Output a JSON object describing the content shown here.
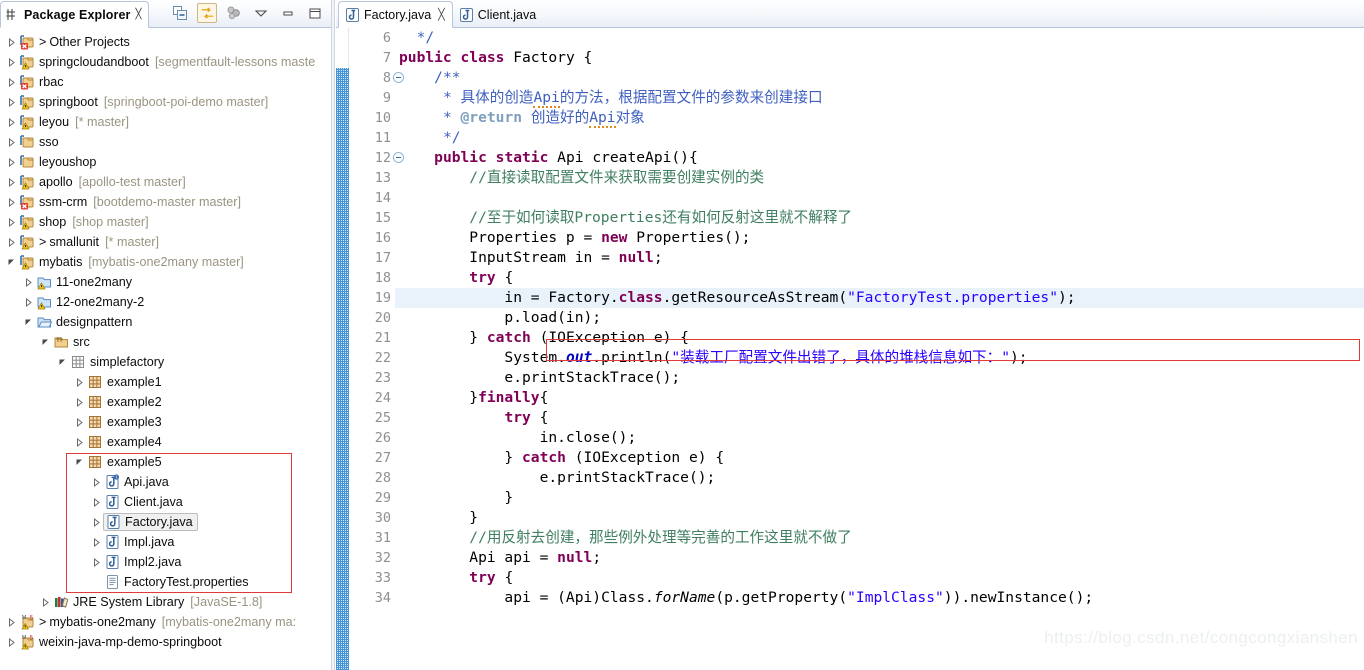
{
  "explorer": {
    "tab_title": "Package Explorer",
    "tab_close": "╳",
    "toolbar": [
      {
        "name": "collapse-all-icon",
        "title": "Collapse All"
      },
      {
        "name": "link-with-editor-icon",
        "title": "Link with Editor"
      },
      {
        "name": "focus-on-active-task-icon",
        "title": "Focus on Active Task"
      },
      {
        "name": "view-menu-icon",
        "title": "View Menu"
      },
      {
        "name": "minimize-icon",
        "title": "Minimize"
      },
      {
        "name": "maximize-icon",
        "title": "Maximize"
      }
    ],
    "tree": [
      {
        "indent": 0,
        "arrow": "collapsed",
        "icon": "project-error-icon",
        "gt": ">",
        "label": "Other Projects",
        "meta": ""
      },
      {
        "indent": 0,
        "arrow": "collapsed",
        "icon": "project-warn-icon",
        "gt": "",
        "label": "springcloudandboot",
        "meta": "[segmentfault-lessons maste"
      },
      {
        "indent": 0,
        "arrow": "collapsed",
        "icon": "project-error-icon",
        "gt": "",
        "label": "rbac",
        "meta": ""
      },
      {
        "indent": 0,
        "arrow": "collapsed",
        "icon": "project-warn-icon",
        "gt": "",
        "label": "springboot",
        "meta": "[springboot-poi-demo master]"
      },
      {
        "indent": 0,
        "arrow": "collapsed",
        "icon": "project-warn-icon",
        "gt": "",
        "label": "leyou",
        "meta": "[* master]"
      },
      {
        "indent": 0,
        "arrow": "collapsed",
        "icon": "project-icon",
        "gt": "",
        "label": "sso",
        "meta": ""
      },
      {
        "indent": 0,
        "arrow": "collapsed",
        "icon": "project-icon",
        "gt": "",
        "label": "leyoushop",
        "meta": ""
      },
      {
        "indent": 0,
        "arrow": "collapsed",
        "icon": "project-warn-icon",
        "gt": "",
        "label": "apollo",
        "meta": "[apollo-test master]"
      },
      {
        "indent": 0,
        "arrow": "collapsed",
        "icon": "project-error-icon",
        "gt": "",
        "label": "ssm-crm",
        "meta": "[bootdemo-master master]"
      },
      {
        "indent": 0,
        "arrow": "collapsed",
        "icon": "project-warn-icon",
        "gt": "",
        "label": "shop",
        "meta": "[shop master]"
      },
      {
        "indent": 0,
        "arrow": "collapsed",
        "icon": "project-warn-icon",
        "gt": ">",
        "label": "smallunit",
        "meta": "[* master]"
      },
      {
        "indent": 0,
        "arrow": "expanded",
        "icon": "project-warn-icon",
        "gt": "",
        "label": "mybatis",
        "meta": "[mybatis-one2many master]"
      },
      {
        "indent": 1,
        "arrow": "collapsed",
        "icon": "folder-warn-icon",
        "gt": "",
        "label": "11-one2many",
        "meta": ""
      },
      {
        "indent": 1,
        "arrow": "collapsed",
        "icon": "folder-warn-icon",
        "gt": "",
        "label": "12-one2many-2",
        "meta": ""
      },
      {
        "indent": 1,
        "arrow": "expanded",
        "icon": "folder-open-icon",
        "gt": "",
        "label": "designpattern",
        "meta": ""
      },
      {
        "indent": 2,
        "arrow": "expanded",
        "icon": "source-folder-icon",
        "gt": "",
        "label": "src",
        "meta": ""
      },
      {
        "indent": 3,
        "arrow": "expanded",
        "icon": "package-empty-icon",
        "gt": "",
        "label": "simplefactory",
        "meta": ""
      },
      {
        "indent": 4,
        "arrow": "collapsed",
        "icon": "package-icon",
        "gt": "",
        "label": "example1",
        "meta": ""
      },
      {
        "indent": 4,
        "arrow": "collapsed",
        "icon": "package-icon",
        "gt": "",
        "label": "example2",
        "meta": ""
      },
      {
        "indent": 4,
        "arrow": "collapsed",
        "icon": "package-icon",
        "gt": "",
        "label": "example3",
        "meta": ""
      },
      {
        "indent": 4,
        "arrow": "collapsed",
        "icon": "package-icon",
        "gt": "",
        "label": "example4",
        "meta": ""
      },
      {
        "indent": 4,
        "arrow": "expanded",
        "icon": "package-icon",
        "gt": "",
        "label": "example5",
        "meta": ""
      },
      {
        "indent": 5,
        "arrow": "collapsed",
        "icon": "interface-file-icon",
        "gt": "",
        "label": "Api.java",
        "meta": ""
      },
      {
        "indent": 5,
        "arrow": "collapsed",
        "icon": "java-file-icon",
        "gt": "",
        "label": "Client.java",
        "meta": ""
      },
      {
        "indent": 5,
        "arrow": "collapsed",
        "icon": "java-file-icon",
        "gt": "",
        "label": "Factory.java",
        "meta": "",
        "selected": true
      },
      {
        "indent": 5,
        "arrow": "collapsed",
        "icon": "java-file-icon",
        "gt": "",
        "label": "Impl.java",
        "meta": ""
      },
      {
        "indent": 5,
        "arrow": "collapsed",
        "icon": "java-file-icon",
        "gt": "",
        "label": "Impl2.java",
        "meta": ""
      },
      {
        "indent": 5,
        "arrow": "none",
        "icon": "properties-file-icon",
        "gt": "",
        "label": "FactoryTest.properties",
        "meta": ""
      },
      {
        "indent": 2,
        "arrow": "collapsed",
        "icon": "library-icon",
        "gt": "",
        "label": "JRE System Library",
        "meta": "[JavaSE-1.8]"
      },
      {
        "indent": 0,
        "arrow": "collapsed",
        "icon": "maven-warn-icon",
        "gt": ">",
        "label": "mybatis-one2many",
        "meta": "[mybatis-one2many ma:"
      },
      {
        "indent": 0,
        "arrow": "collapsed",
        "icon": "maven-warn-icon",
        "gt": "",
        "label": "weixin-java-mp-demo-springboot",
        "meta": ""
      }
    ]
  },
  "editor": {
    "tabs": [
      {
        "label": "Factory.java",
        "active": true,
        "close": "╳",
        "icon": "java-file-icon"
      },
      {
        "label": "Client.java",
        "active": false,
        "close": "",
        "icon": "java-file-icon"
      }
    ],
    "first_line": 6,
    "highlighted_line": 19,
    "fold_lines": [
      8,
      12
    ],
    "line_numbers": [
      6,
      7,
      8,
      9,
      10,
      11,
      12,
      13,
      14,
      15,
      16,
      17,
      18,
      19,
      20,
      21,
      22,
      23,
      24,
      25,
      26,
      27,
      28,
      29,
      30,
      31,
      32,
      33,
      34
    ],
    "lines": [
      {
        "n": 6,
        "html": "  <span class=\"jd\">*/</span>"
      },
      {
        "n": 7,
        "html": "<span class=\"k\">public class</span> Factory {"
      },
      {
        "n": 8,
        "html": "    <span class=\"jd\">/**</span>"
      },
      {
        "n": 9,
        "html": "     <span class=\"jd\">* 具体的创造<span class=\"u\">Api</span>的方法，根据配置文件的参数来创建接口</span>"
      },
      {
        "n": 10,
        "html": "     <span class=\"jd\">* <span class=\"jdt\">@return</span> 创造好的<span class=\"u\">Api</span>对象</span>"
      },
      {
        "n": 11,
        "html": "     <span class=\"jd\">*/</span>"
      },
      {
        "n": 12,
        "html": "    <span class=\"k\">public static</span> Api createApi(){"
      },
      {
        "n": 13,
        "html": "        <span class=\"c\">//直接读取配置文件来获取需要创建实例的类</span>"
      },
      {
        "n": 14,
        "html": ""
      },
      {
        "n": 15,
        "html": "        <span class=\"c\">//至于如何读取Properties还有如何反射这里就不解释了</span>"
      },
      {
        "n": 16,
        "html": "        Properties p = <span class=\"k\">new</span> Properties();"
      },
      {
        "n": 17,
        "html": "        InputStream in = <span class=\"k\">null</span>;"
      },
      {
        "n": 18,
        "html": "        <span class=\"k\">try</span> {"
      },
      {
        "n": 19,
        "html": "            in = Factory.<span class=\"k\">class</span>.getResourceAsStream(<span class=\"s\">\"FactoryTest.properties\"</span>);"
      },
      {
        "n": 20,
        "html": "            p.load(in);"
      },
      {
        "n": 21,
        "html": "        } <span class=\"k\">catch</span> (IOException e) {"
      },
      {
        "n": 22,
        "html": "            System.<span class=\"st\">out</span>.println(<span class=\"s\">\"装载工厂配置文件出错了，具体的堆栈信息如下：\"</span>);"
      },
      {
        "n": 23,
        "html": "            e.printStackTrace();"
      },
      {
        "n": 24,
        "html": "        }<span class=\"k\">finally</span>{"
      },
      {
        "n": 25,
        "html": "            <span class=\"k\">try</span> {"
      },
      {
        "n": 26,
        "html": "                in.close();"
      },
      {
        "n": 27,
        "html": "            } <span class=\"k\">catch</span> (IOException e) {"
      },
      {
        "n": 28,
        "html": "                e.printStackTrace();"
      },
      {
        "n": 29,
        "html": "            }"
      },
      {
        "n": 30,
        "html": "        }"
      },
      {
        "n": 31,
        "html": "        <span class=\"c\">//用反射去创建，那些例外处理等完善的工作这里就不做了</span>"
      },
      {
        "n": 32,
        "html": "        Api api = <span class=\"k\">null</span>;"
      },
      {
        "n": 33,
        "html": "        <span class=\"k\">try</span> {"
      },
      {
        "n": 34,
        "html": "            api = (Api)Class.<span class=\"sm\">forName</span>(p.getProperty(<span class=\"s\">\"ImplClass\"</span>)).newInstance();"
      }
    ]
  },
  "watermark": "https://blog.csdn.net/congcongxianshen",
  "colors": {
    "keyword": "#7f0055",
    "string": "#2a00ff",
    "comment": "#3f7f5f",
    "javadoc": "#3f5fbf",
    "annotation_bar": "#3a8fd4",
    "selection_box": "#e03a3a",
    "line_highlight": "#e9f2fb",
    "tab_border": "#b6c6dc"
  }
}
